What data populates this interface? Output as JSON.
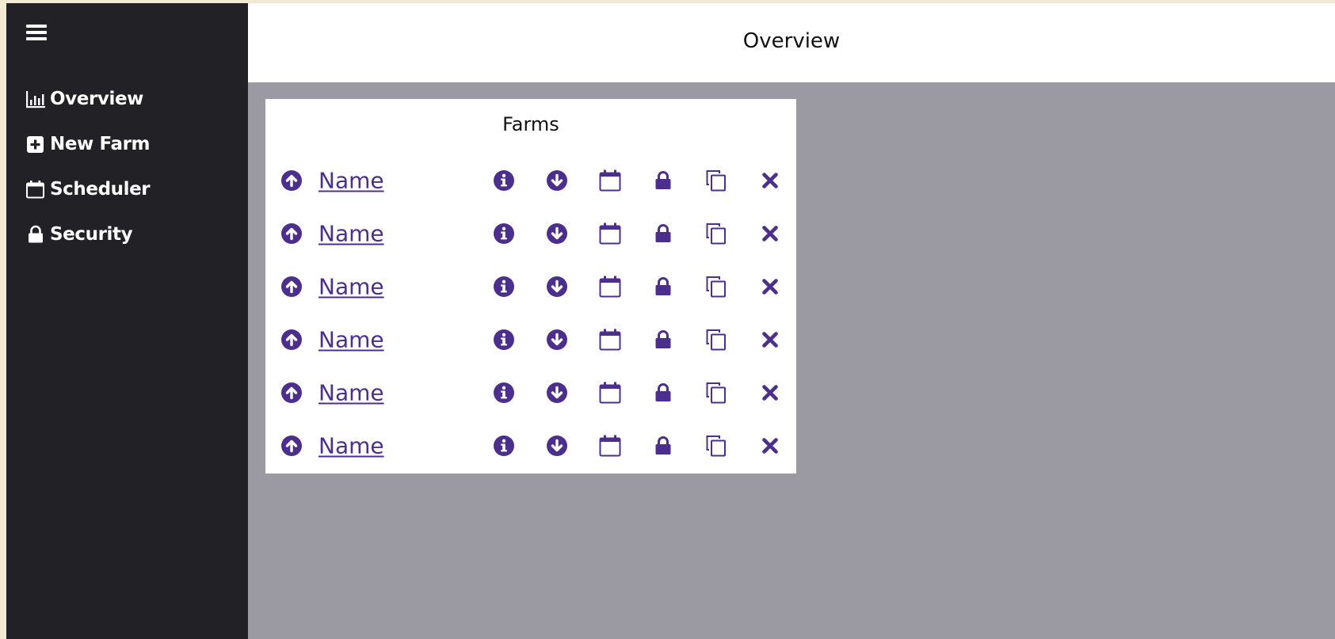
{
  "colors": {
    "sidebar_bg": "#222226",
    "main_bg": "#9b9aa3",
    "accent_purple": "#4c2f8c",
    "outer_frame": "#f3ead3"
  },
  "sidebar": {
    "menu_icon": "hamburger-icon",
    "items": [
      {
        "label": "Overview",
        "icon": "bar-chart-icon"
      },
      {
        "label": "New Farm",
        "icon": "plus-square-icon"
      },
      {
        "label": "Scheduler",
        "icon": "calendar-icon"
      },
      {
        "label": "Security",
        "icon": "lock-icon"
      }
    ]
  },
  "header": {
    "title": "Overview"
  },
  "farms": {
    "title": "Farms",
    "row_icons": [
      "arrow-up-circle-icon",
      "info-circle-icon",
      "arrow-down-circle-icon",
      "calendar-icon",
      "lock-icon",
      "copy-icon",
      "close-icon"
    ],
    "rows": [
      {
        "name": "Name"
      },
      {
        "name": "Name"
      },
      {
        "name": "Name"
      },
      {
        "name": "Name"
      },
      {
        "name": "Name"
      },
      {
        "name": "Name"
      }
    ]
  }
}
